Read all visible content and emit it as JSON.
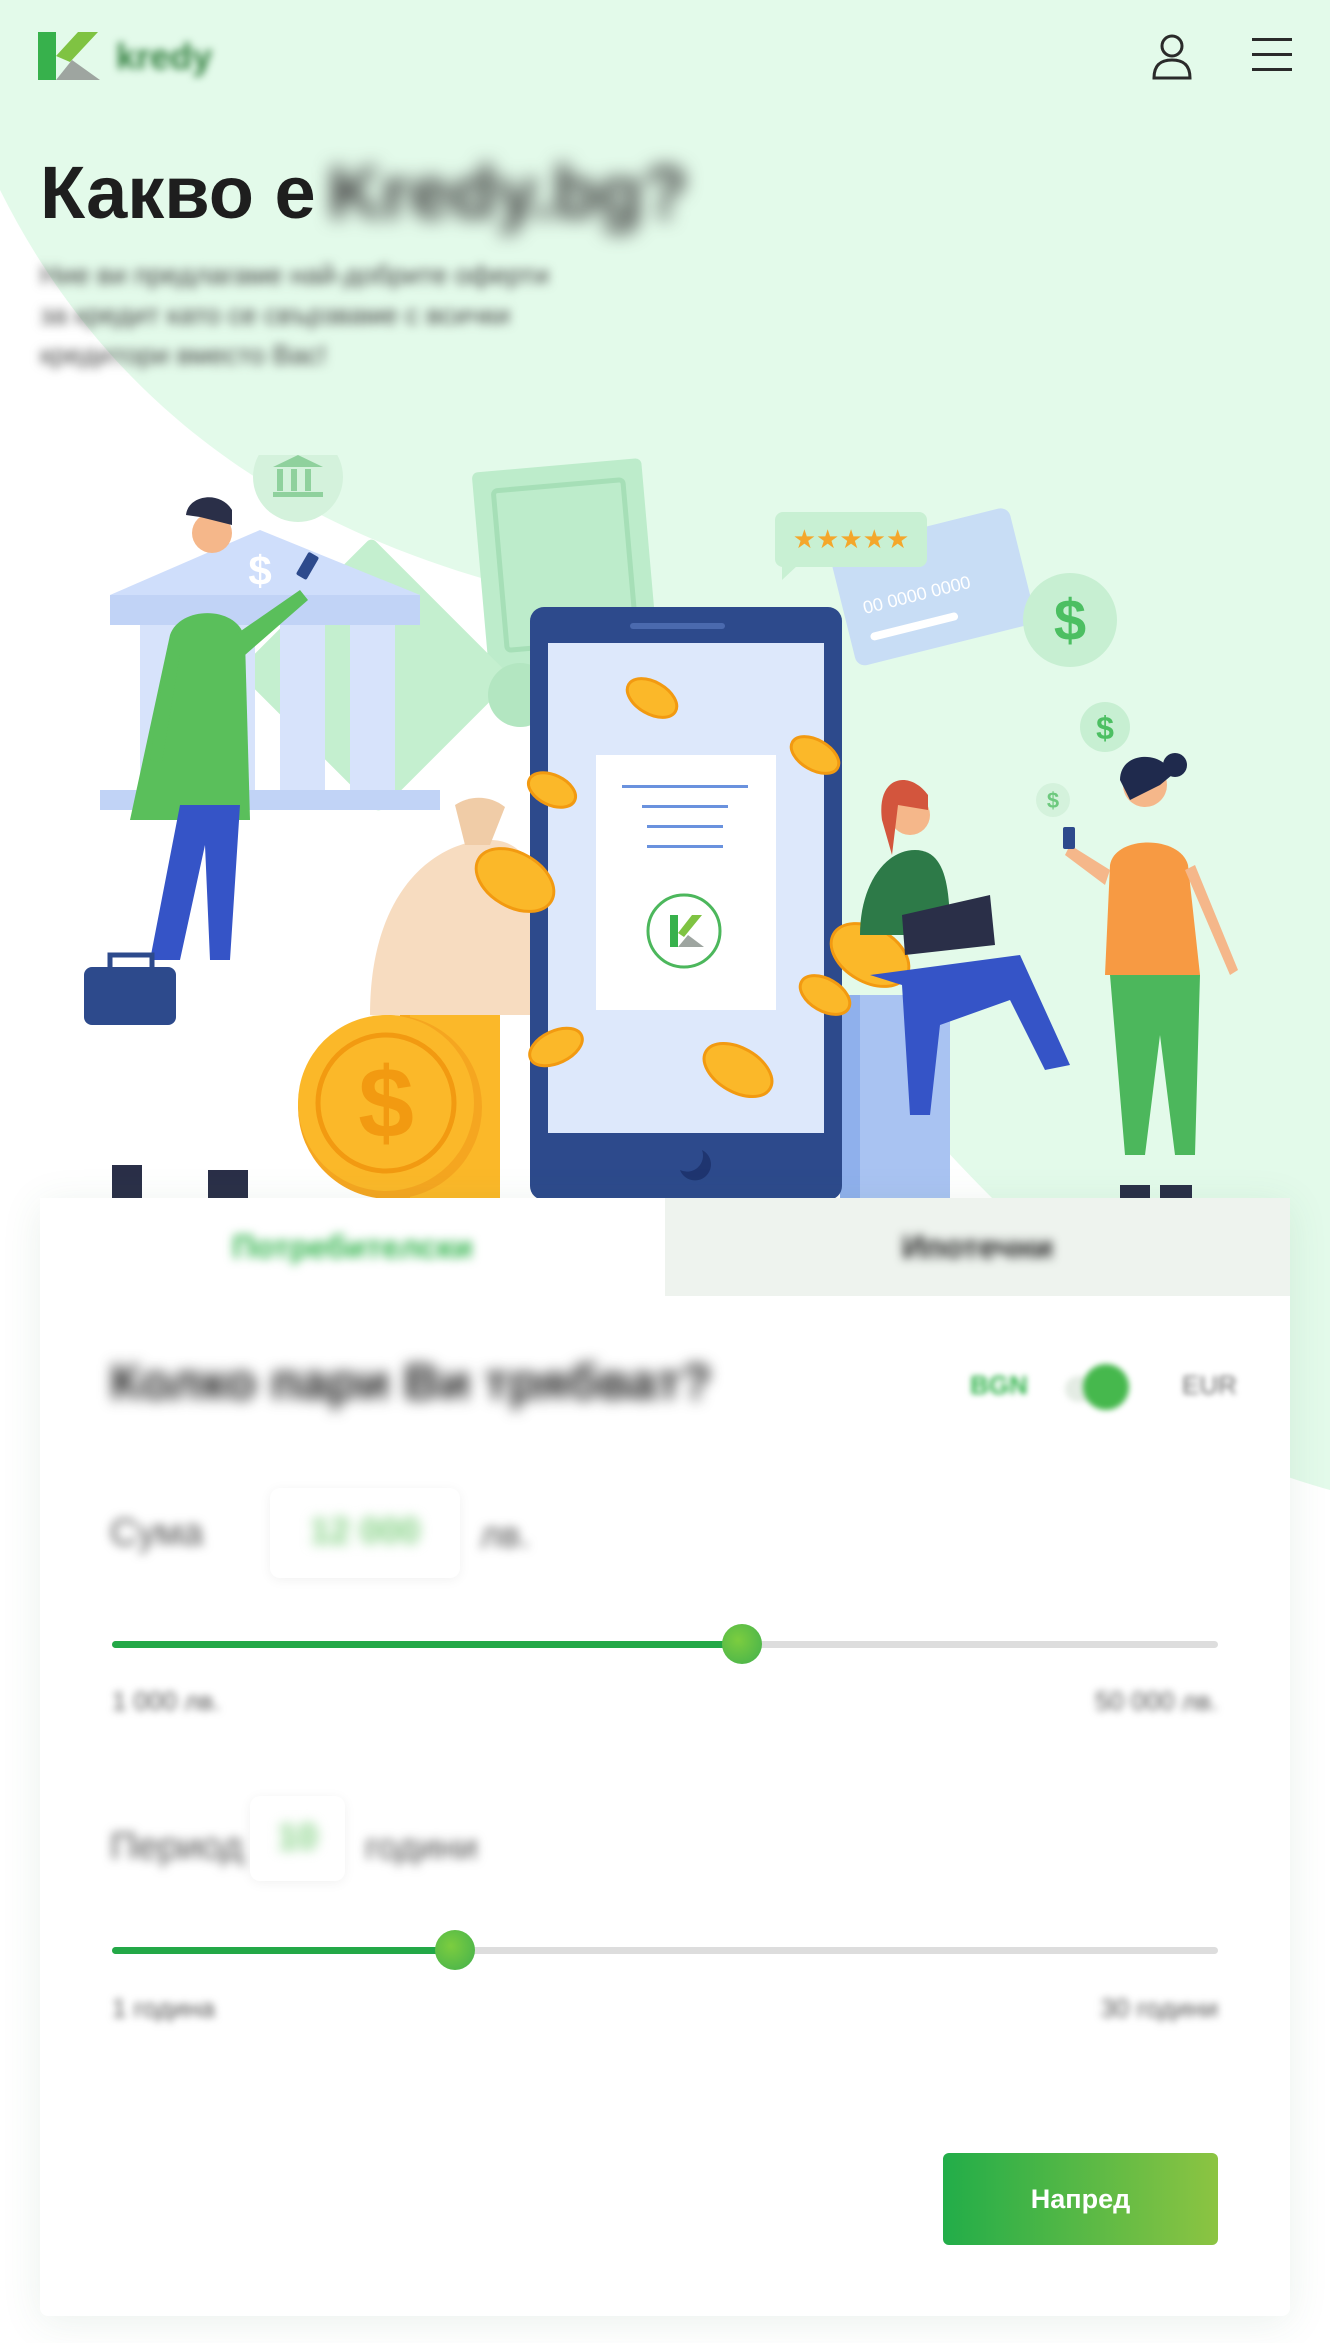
{
  "brand": {
    "name": "kredy",
    "primary_color": "#2fb34a",
    "accent_color": "#8cc442"
  },
  "header": {
    "user_icon": "user-icon",
    "menu_icon": "hamburger-menu-icon"
  },
  "hero": {
    "title_prefix": "Какво е",
    "title_blurred": "Kredy.bg?",
    "subtitle": "Ние ви предлагаме най-добрите оферти за кредит като се свързваме с всички кредитори вместо Вас!"
  },
  "illustration": {
    "card_number": "00 0000 0000",
    "currency_symbol": "$"
  },
  "calculator": {
    "tabs": [
      {
        "label": "Потребителски",
        "active": true
      },
      {
        "label": "Ипотечни",
        "active": false
      }
    ],
    "question": "Колко пари Ви трябват?",
    "toggle": {
      "left": "BGN",
      "right": "EUR"
    },
    "amount": {
      "label": "Сума",
      "value": "12 000",
      "unit": "лв.",
      "min_label": "1 000 лв.",
      "max_label": "50 000 лв.",
      "fill_percent": 57
    },
    "period": {
      "label": "Период",
      "value": "10",
      "unit": "години",
      "min_label": "1 година",
      "max_label": "30 години",
      "fill_percent": 31
    },
    "next_button": "Напред"
  }
}
